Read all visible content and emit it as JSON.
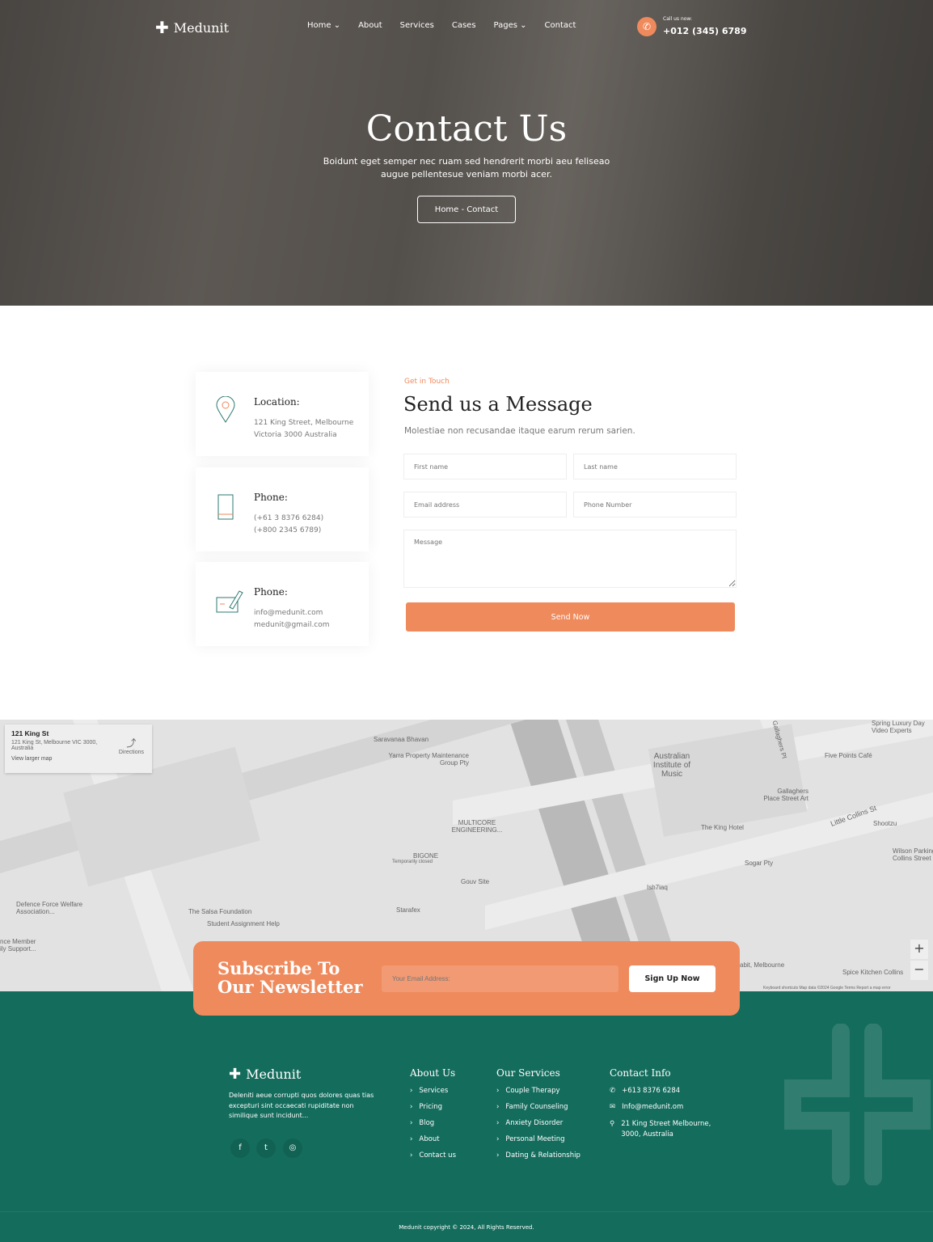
{
  "brand": {
    "name": "Medunit",
    "accent": "#ef8a5c",
    "footer_bg": "#146c5c"
  },
  "nav": {
    "items": [
      "Home",
      "About",
      "Services",
      "Cases",
      "Pages",
      "Contact"
    ],
    "call_label": "Call us now:",
    "call_number": "+012 (345) 6789"
  },
  "hero": {
    "title": "Contact Us",
    "description": "Boidunt eget semper nec ruam sed hendrerit morbi aeu feliseao augue pellentesue veniam morbi acer.",
    "breadcrumb": "Home - Contact"
  },
  "contact_cards": [
    {
      "icon": "location-pin-icon",
      "title": "Location:",
      "lines": [
        "121 King Street, Melbourne",
        "Victoria 3000 Australia"
      ]
    },
    {
      "icon": "mobile-phone-icon",
      "title": "Phone:",
      "lines": [
        "(+61 3 8376 6284)",
        "(+800 2345 6789)"
      ]
    },
    {
      "icon": "write-note-icon",
      "title": "Phone:",
      "lines": [
        "info@medunit.com",
        "medunit@gmail.com"
      ]
    }
  ],
  "form": {
    "eyebrow": "Get in Touch",
    "title": "Send us a Message",
    "subtitle": "Molestiae non recusandae itaque earum rerum sarien.",
    "first_name": "First name",
    "last_name": "Last name",
    "email": "Email address",
    "phone": "Phone Number",
    "message": "Message",
    "submit": "Send Now"
  },
  "map": {
    "place_title": "121 King St",
    "place_address": "121 King St, Melbourne VIC 3000, Australia",
    "directions": "Directions",
    "view_larger": "View larger map",
    "labels": [
      "Saravanaa Bhavan",
      "Yarra Property Maintenance Group Pty",
      "MULTICORE ENGINEERING...",
      "BIGONE",
      "Temporarily closed",
      "Gouv Site",
      "Defence Force Welfare Association...",
      "The Salsa Foundation",
      "Student Assignment Help",
      "Starafex",
      "Australian Institute of Music",
      "Gallaghers Pl",
      "Gallaghers Place Street Art",
      "The King Hotel",
      "Sogar Pty",
      "Little Collins St",
      "Shootzu",
      "Wilson Parking Collins Street",
      "Ish7iaq",
      "Five Points Café",
      "Spring Luxury Day Video Experts",
      "Spice Kitchen Collins",
      "abit, Melbourne",
      "nce Member ily Support..."
    ],
    "attribution": "Keyboard shortcuts   Map data ©2024 Google   Terms   Report a map error"
  },
  "newsletter": {
    "title": "Subscribe To Our Newsletter",
    "placeholder": "Your Email Address:",
    "button": "Sign Up Now"
  },
  "footer": {
    "about": "Deleniti aeue corrupti quos dolores quas tias excepturi sint occaecati rupiditate non similique sunt incidunt...",
    "about_us": {
      "title": "About Us",
      "links": [
        "Services",
        "Pricing",
        "Blog",
        "About",
        "Contact us"
      ]
    },
    "services": {
      "title": "Our Services",
      "links": [
        "Couple Therapy",
        "Family Counseling",
        "Anxiety Disorder",
        "Personal Meeting",
        "Dating & Relationship"
      ]
    },
    "contact": {
      "title": "Contact Info",
      "phone": "+613 8376 6284",
      "email": "Info@medunit.om",
      "address": "21 King Street Melbourne, 3000, Australia"
    },
    "copyright": "Medunit copyright © 2024, All Rights Reserved."
  }
}
